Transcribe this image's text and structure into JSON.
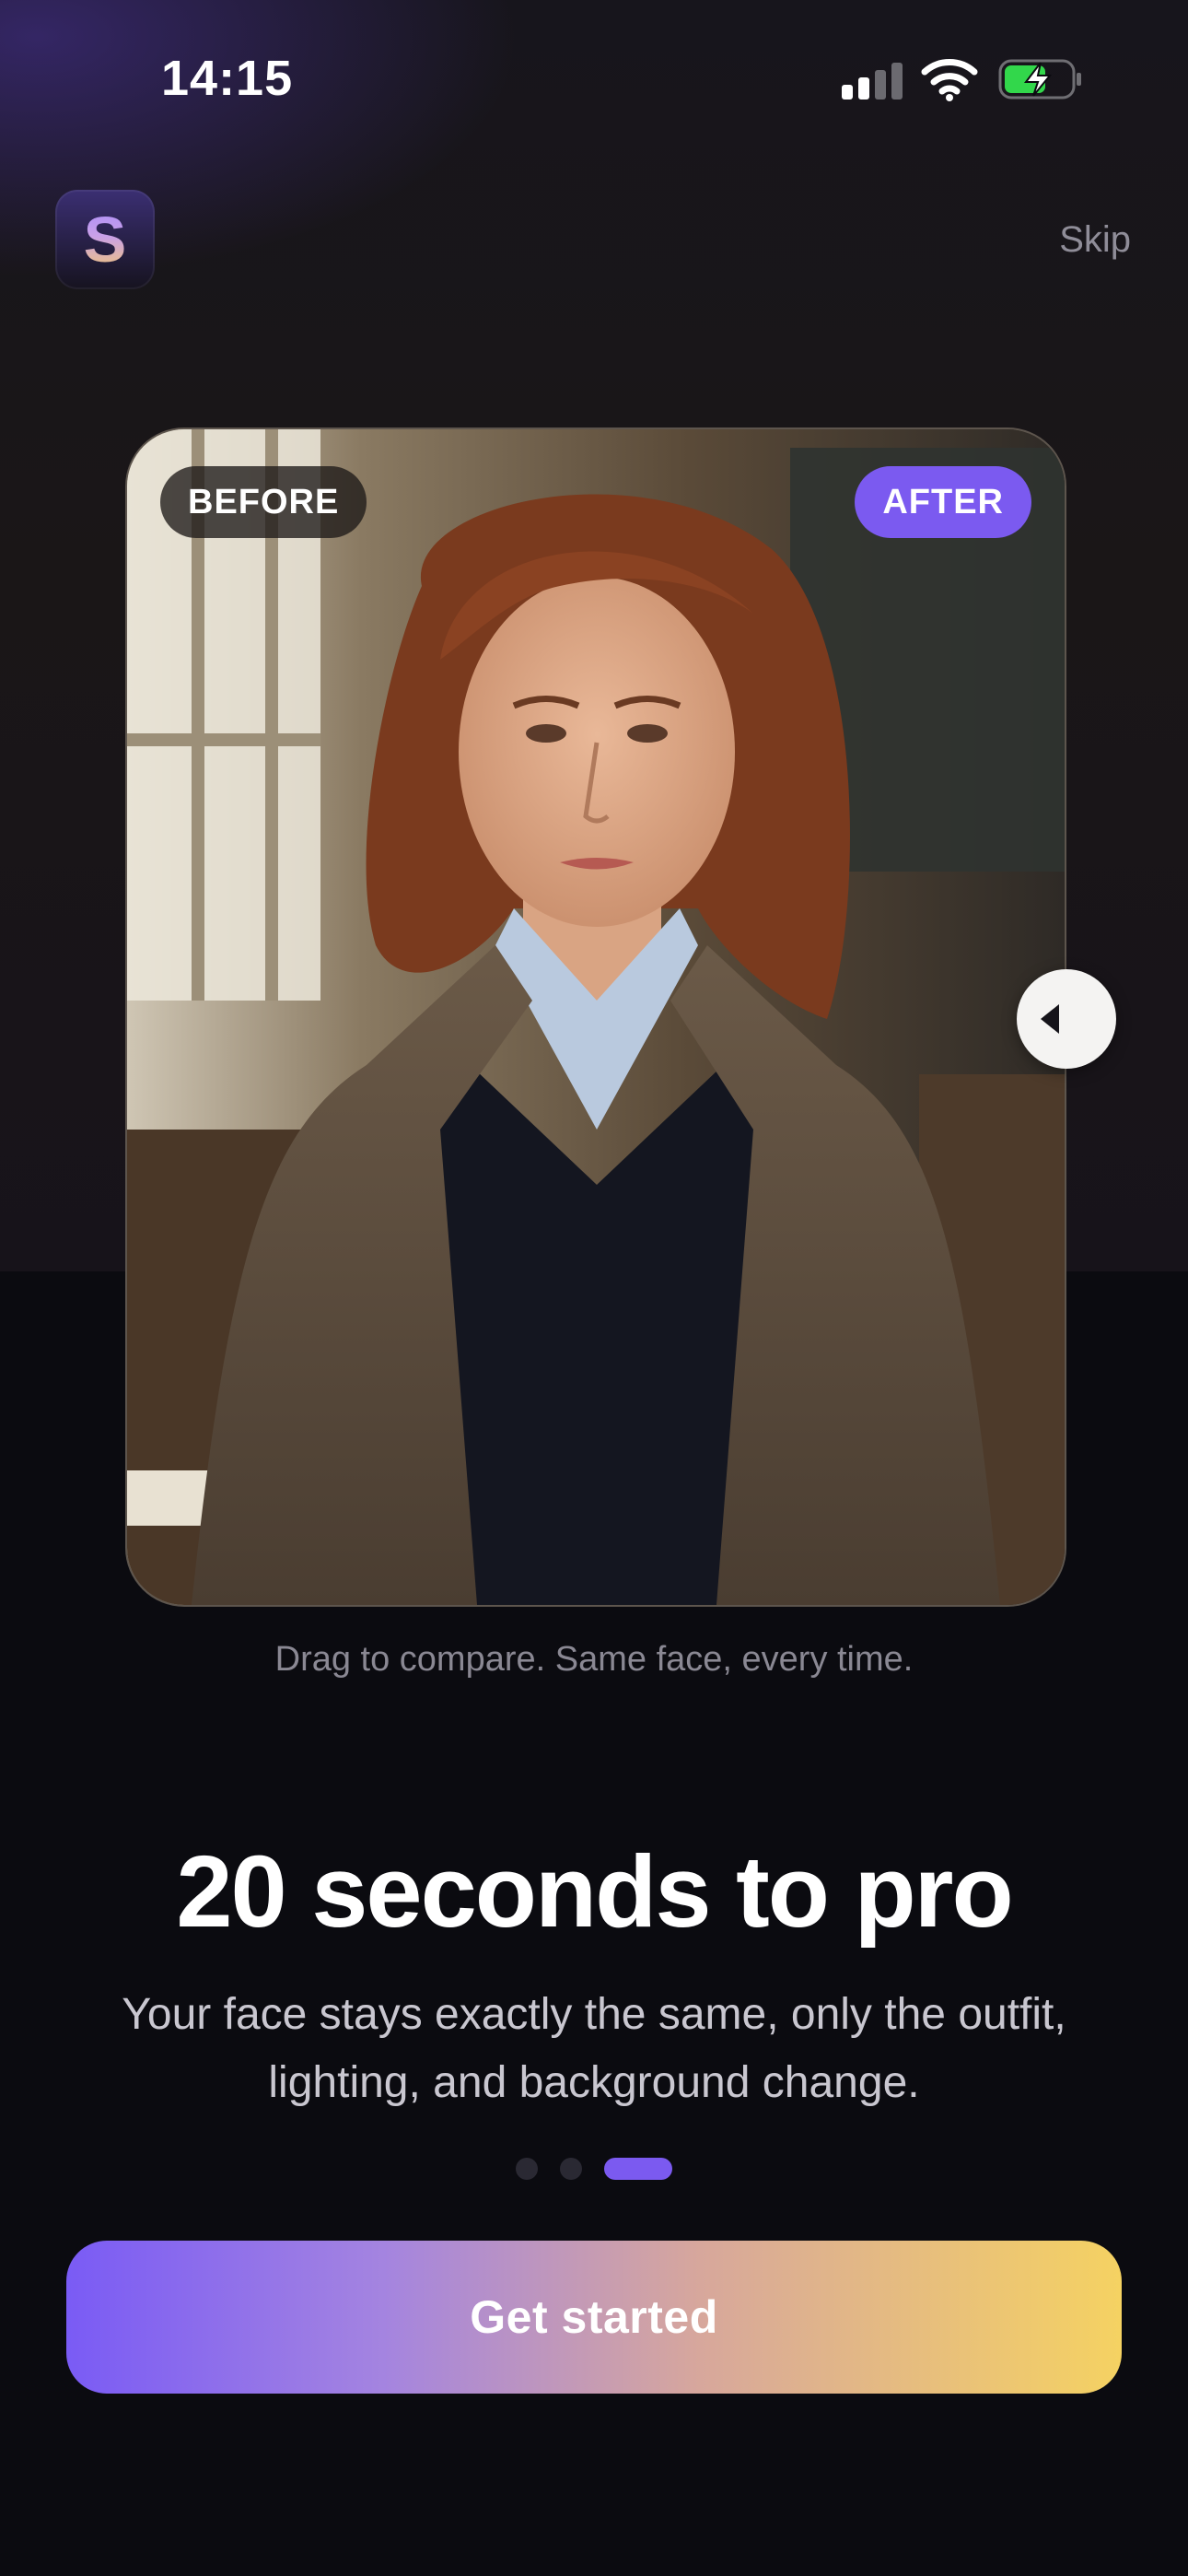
{
  "status_bar": {
    "time": "14:15"
  },
  "header": {
    "logo_letter": "S",
    "skip_label": "Skip"
  },
  "compare": {
    "before_label": "BEFORE",
    "after_label": "AFTER",
    "caption": "Drag to compare. Same face, every time."
  },
  "onboarding": {
    "title": "20 seconds to pro",
    "subtitle": "Your face stays exactly the same, only the outfit, lighting, and background change.",
    "total_pages": 3,
    "active_page": 3
  },
  "cta": {
    "label": "Get started"
  },
  "colors": {
    "accent": "#7b5af0",
    "background": "#0b0b10",
    "gradient_end": "#f5d262"
  }
}
